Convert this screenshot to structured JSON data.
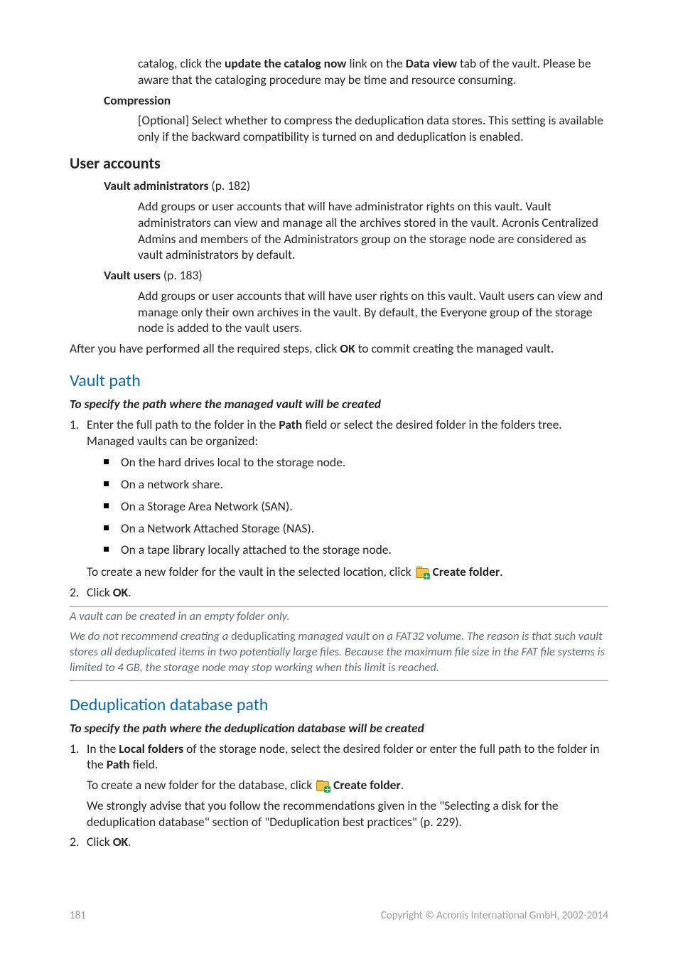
{
  "para_catalog": {
    "pre": "catalog, click the ",
    "b1": "update the catalog now",
    "mid": " link on the ",
    "b2": "Data view",
    "post": " tab of the vault. Please be aware that the cataloging procedure may be time and resource consuming."
  },
  "h_compression": "Compression",
  "para_compression": "[Optional] Select whether to compress the deduplication data stores. This setting is available only if the backward compatibility is turned on and deduplication is enabled.",
  "h_user_accounts": "User accounts",
  "h_vault_admins": {
    "t": "Vault administrators",
    "page": " (p. 182)"
  },
  "para_vault_admins": "Add groups or user accounts that will have administrator rights on this vault. Vault administrators can view and manage all the archives stored in the vault. Acronis Centralized Admins and members of the Administrators group on the storage node are considered as vault administrators by default.",
  "h_vault_users": {
    "t": "Vault users",
    "page": " (p. 183)"
  },
  "para_vault_users": "Add groups or user accounts that will have user rights on this vault. Vault users can view and manage only their own archives in the vault. By default, the Everyone group of the storage node is added to the vault users.",
  "para_after": {
    "pre": "After you have performed all the required steps, click ",
    "b": "OK",
    "post": " to commit creating the managed vault."
  },
  "h_vault_path": "Vault path",
  "h_vp_sub": "To specify the path where the managed vault will be created",
  "vp_step1": {
    "pre": "Enter the full path to the folder in the ",
    "b": "Path",
    "post": " field or select the desired folder in the folders tree. Managed vaults can be organized:"
  },
  "vp_bullets": [
    "On the hard drives local to the storage node.",
    "On a network share.",
    "On a Storage Area Network (SAN).",
    "On a Network Attached Storage (NAS).",
    "On a tape library locally attached to the storage node."
  ],
  "vp_create": {
    "pre": "To create a new folder for the vault in the selected location, click ",
    "b": "Create folder",
    "post": "."
  },
  "vp_step2": {
    "pre": "Click ",
    "b": "OK",
    "post": "."
  },
  "note1": "A vault can be created in an empty folder only.",
  "note2": {
    "p1": "We do not recommend creating a ",
    "roman": "deduplicating",
    "p2": " managed vault on a FAT32 volume. The reason is that such vault stores all deduplicated items in two potentially large files. Because the maximum file size in the FAT file systems is limited to 4 GB, the storage node may stop working when this limit is reached."
  },
  "h_dedup": "Deduplication database path",
  "h_dd_sub": "To specify the path where the deduplication database will be created",
  "dd_step1": {
    "p1": "In the ",
    "b1": "Local folders",
    "p2": " of the storage node, select the desired folder or enter the full path to the folder in the ",
    "b2": "Path",
    "p3": " field."
  },
  "dd_create": {
    "pre": "To create a new folder for the database, click ",
    "b": "Create folder",
    "post": "."
  },
  "dd_advise": "We strongly advise that you follow the recommendations given in the \"Selecting a disk for the deduplication database\" section of \"Deduplication best practices\" (p. 229).",
  "dd_step2": {
    "pre": "Click ",
    "b": "OK",
    "post": "."
  },
  "footer": {
    "page": "181",
    "copy": "Copyright © Acronis International GmbH, 2002-2014"
  }
}
